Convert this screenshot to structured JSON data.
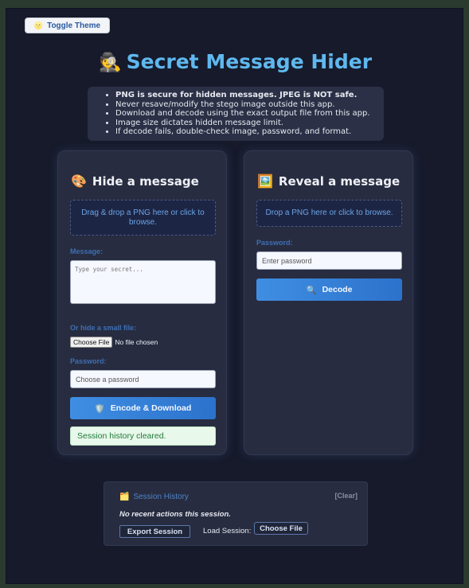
{
  "toggle_theme": {
    "icon": "🌝",
    "label": "Toggle Theme"
  },
  "title": {
    "icon": "🕵️",
    "text": "Secret Message Hider"
  },
  "tips": [
    "PNG is secure for hidden messages. JPEG is NOT safe.",
    "Never resave/modify the stego image outside this app.",
    "Download and decode using the exact output file from this app.",
    "Image size dictates hidden message limit.",
    "If decode fails, double-check image, password, and format."
  ],
  "hide": {
    "icon": "🎨",
    "heading": "Hide a message",
    "dropzone": "Drag & drop a PNG here or click to browse.",
    "message_label": "Message:",
    "message_placeholder": "Type your secret...",
    "file_label": "Or hide a small file:",
    "choose_file": "Choose File",
    "no_file": "No file chosen",
    "password_label": "Password:",
    "password_placeholder": "Choose a password",
    "encode_icon": "🛡️",
    "encode_label": "Encode & Download",
    "status": "Session history cleared."
  },
  "reveal": {
    "icon": "🖼️",
    "heading": "Reveal a message",
    "dropzone": "Drop a PNG here or click to browse.",
    "password_label": "Password:",
    "password_placeholder": "Enter password",
    "decode_icon": "🔍",
    "decode_label": "Decode"
  },
  "history": {
    "icon": "🗂️",
    "title": "Session History",
    "clear": "[Clear]",
    "empty": "No recent actions this session.",
    "export": "Export Session",
    "load_label": "Load Session:",
    "choose_file": "Choose File"
  }
}
